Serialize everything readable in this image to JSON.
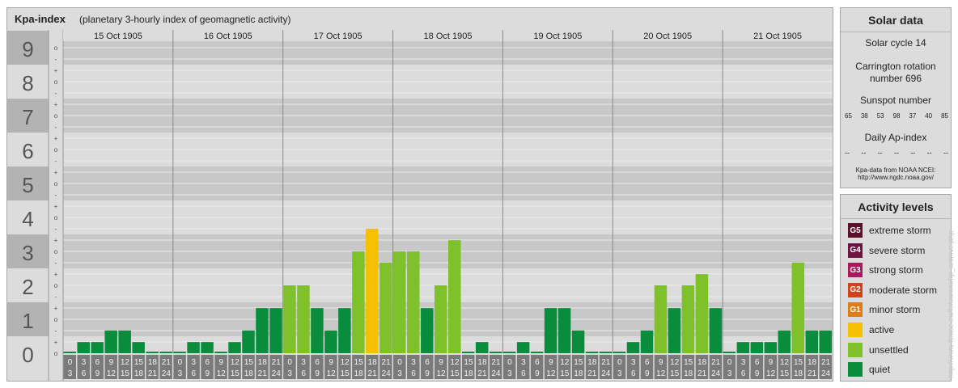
{
  "header": {
    "title": "Kpa-index",
    "subtitle": "(planetary 3-hourly index of geomagnetic activity)"
  },
  "solar": {
    "title": "Solar data",
    "cycle": "Solar cycle 14",
    "rotation_line1": "Carrington rotation",
    "rotation_line2": "number 696",
    "sunspot_label": "Sunspot number",
    "sunspot_values": [
      "65",
      "38",
      "53",
      "98",
      "37",
      "40",
      "85"
    ],
    "ap_label": "Daily Ap-index",
    "ap_values": [
      "--",
      "--",
      "--",
      "--",
      "--",
      "--",
      "--"
    ],
    "credit_line1": "Kpa-data from NOAA NCEI:",
    "credit_line2": "http://www.ngdc.noaa.gov/"
  },
  "activity": {
    "title": "Activity levels",
    "levels": [
      {
        "code": "G5",
        "label": "extreme storm",
        "color": "#5a0f2a"
      },
      {
        "code": "G4",
        "label": "severe storm",
        "color": "#6e1240"
      },
      {
        "code": "G3",
        "label": "strong storm",
        "color": "#a81a5c"
      },
      {
        "code": "G2",
        "label": "moderate storm",
        "color": "#d4421b"
      },
      {
        "code": "G1",
        "label": "minor storm",
        "color": "#e07d12"
      },
      {
        "code": "",
        "label": "active",
        "color": "#f5c000"
      },
      {
        "code": "",
        "label": "unsettled",
        "color": "#7ec12b"
      },
      {
        "code": "",
        "label": "quiet",
        "color": "#0a8c3d"
      }
    ]
  },
  "watermark": "http://www.fleuse.eu/fe/aurora/kp_archive.php",
  "chart_data": {
    "type": "bar",
    "title": "Kpa-index",
    "subtitle": "(planetary 3-hourly index of geomagnetic activity)",
    "ylim": [
      0,
      9
    ],
    "y_ticks": [
      "0",
      "1",
      "2",
      "3",
      "4",
      "5",
      "6",
      "7",
      "8",
      "9"
    ],
    "minor_tick_labels": [
      "+",
      "o",
      "-"
    ],
    "days": [
      "15 Oct 1905",
      "16 Oct 1905",
      "17 Oct 1905",
      "18 Oct 1905",
      "19 Oct 1905",
      "20 Oct 1905",
      "21 Oct 1905"
    ],
    "interval_starts": [
      "0",
      "3",
      "6",
      "9",
      "12",
      "15",
      "18",
      "21"
    ],
    "interval_ends": [
      "3",
      "6",
      "9",
      "12",
      "15",
      "18",
      "21",
      "24"
    ],
    "series": [
      {
        "values": [
          0.0,
          0.33,
          0.33,
          0.67,
          0.67,
          0.33,
          0.0,
          0.0,
          0.0,
          0.33,
          0.33,
          0.0,
          0.33,
          0.67,
          1.33,
          1.33,
          2.0,
          2.0,
          1.33,
          0.67,
          1.33,
          3.0,
          3.67,
          2.67,
          3.0,
          3.0,
          1.33,
          2.0,
          3.33,
          0.0,
          0.33,
          0.0,
          0.0,
          0.33,
          0.0,
          1.33,
          1.33,
          0.67,
          0.0,
          0.0,
          0.0,
          0.33,
          0.67,
          2.0,
          1.33,
          2.0,
          2.33,
          1.33,
          0.0,
          0.33,
          0.33,
          0.33,
          0.67,
          2.67,
          0.67,
          0.67
        ]
      }
    ],
    "category_thresholds": {
      "quiet_below": 2.0,
      "unsettled_below": 3.67,
      "active_below": 5.0
    },
    "colors": {
      "quiet": "#0a8c3d",
      "unsettled": "#7ec12b",
      "active": "#f5c000",
      "band_dark": "#c8c8c8",
      "band_light": "#dcdcdc",
      "axis_box": "#b3b3b3",
      "bottom_labels": "#7a7a7a"
    }
  }
}
